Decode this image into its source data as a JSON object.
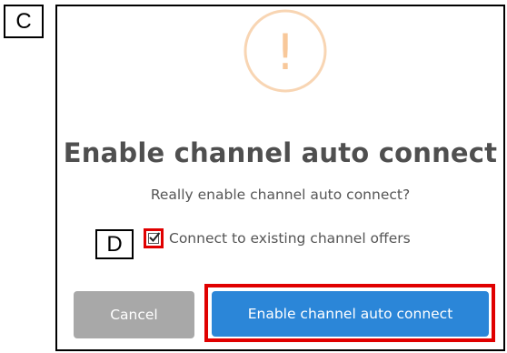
{
  "callouts": {
    "c": "C",
    "d": "D"
  },
  "dialog": {
    "icon": "exclamation-circle-icon",
    "icon_text": "!",
    "title": "Enable channel auto connect",
    "message": "Really enable channel auto connect?",
    "checkbox": {
      "label": "Connect to existing channel offers",
      "checked": true
    },
    "buttons": {
      "cancel": "Cancel",
      "confirm": "Enable channel auto connect"
    }
  },
  "colors": {
    "warning": "#f8bb86",
    "confirm": "#2b86d8",
    "cancel": "#a8a8a8",
    "highlight": "#e00000"
  }
}
